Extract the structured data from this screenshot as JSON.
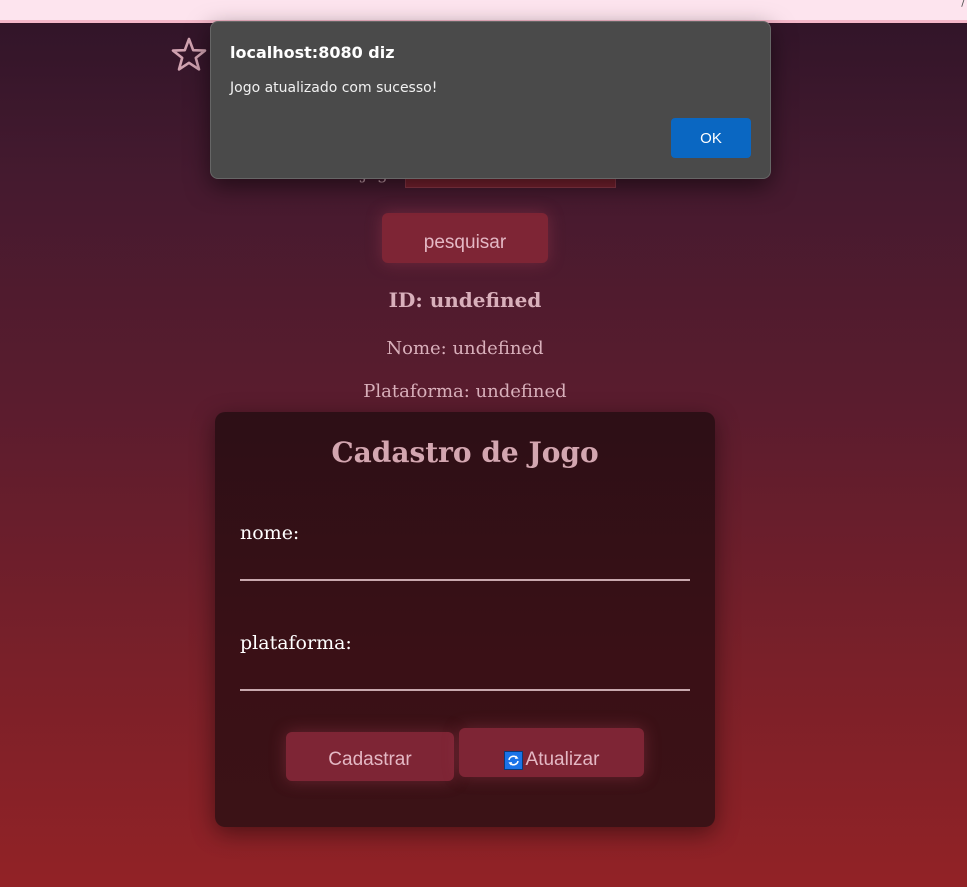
{
  "browser": {
    "corner_glyph": "/"
  },
  "search": {
    "label": "Id do jogo:",
    "value": "",
    "button_label": "pesquisar"
  },
  "result": {
    "id_text": "ID: undefined",
    "nome_text": "Nome: undefined",
    "plataforma_text": "Plataforma: undefined"
  },
  "form": {
    "title": "Cadastro de Jogo",
    "nome_label": "nome:",
    "nome_value": "",
    "plataforma_label": "plataforma:",
    "plataforma_value": "",
    "cadastrar_label": "Cadastrar",
    "atualizar_label": "Atualizar",
    "atualizar_icon": "refresh-icon"
  },
  "dialog": {
    "title": "localhost:8080 diz",
    "message": "Jogo atualizado com sucesso!",
    "ok_label": "OK"
  },
  "colors": {
    "background_top": "#2f1428",
    "background_bottom": "#922226",
    "button": "#7e2535",
    "card": "#3a1016",
    "dialog": "#4a4a4a",
    "dialog_ok": "#0a67c2"
  }
}
